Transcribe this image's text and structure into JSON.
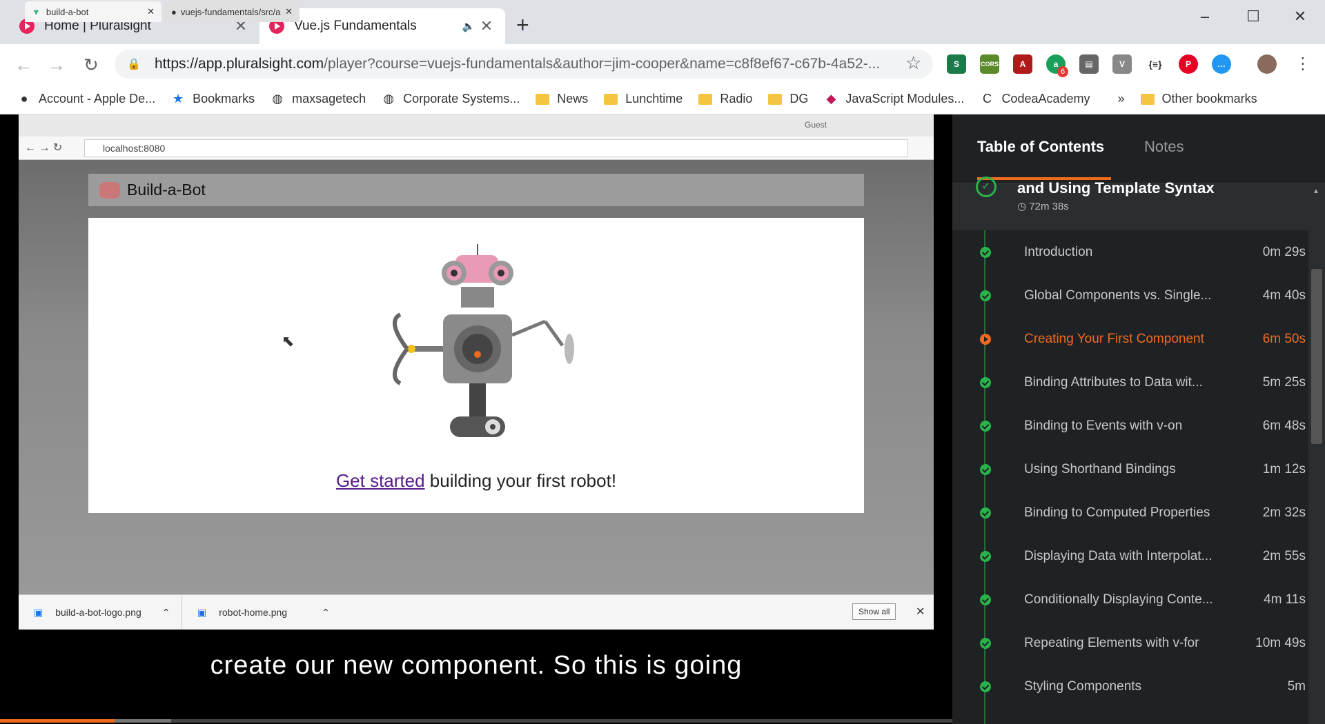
{
  "browser": {
    "tabs": [
      {
        "title": "Home | Pluralsight"
      },
      {
        "title": "Vue.js Fundamentals"
      }
    ],
    "url_host": "https://app.pluralsight.com",
    "url_path": "/player?course=vuejs-fundamentals&author=jim-cooper&name=c8f8ef67-c67b-4a52-...",
    "extension_badge": "6",
    "bookmarks": [
      "Account - Apple De...",
      "Bookmarks",
      "maxsagetech",
      "Corporate Systems...",
      "News",
      "Lunchtime",
      "Radio",
      "DG",
      "JavaScript Modules...",
      "CodeaAcademy"
    ],
    "bookmarks_overflow": "»",
    "other_bookmarks": "Other bookmarks"
  },
  "inner_browser": {
    "tabs": [
      {
        "title": "build-a-bot"
      },
      {
        "title": "vuejs-fundamentals/src/a"
      }
    ],
    "profile": "Guest",
    "address": "localhost:8080",
    "app_title": "Build-a-Bot",
    "link_text": "Get started",
    "tagline": " building your first robot!",
    "downloads": [
      "build-a-bot-logo.png",
      "robot-home.png"
    ],
    "show_all": "Show all"
  },
  "caption": "create our new component. So this is going",
  "sidebar": {
    "tab_toc": "Table of Contents",
    "tab_notes": "Notes",
    "module_title": "and Using Template Syntax",
    "module_duration": "72m 38s",
    "clips": [
      {
        "title": "Introduction",
        "duration": "0m 29s",
        "state": "done"
      },
      {
        "title": "Global Components vs. Single...",
        "duration": "4m 40s",
        "state": "done"
      },
      {
        "title": "Creating Your First Component",
        "duration": "6m 50s",
        "state": "current"
      },
      {
        "title": "Binding Attributes to Data wit...",
        "duration": "5m 25s",
        "state": "done"
      },
      {
        "title": "Binding to Events with v-on",
        "duration": "6m 48s",
        "state": "done"
      },
      {
        "title": "Using Shorthand Bindings",
        "duration": "1m 12s",
        "state": "done"
      },
      {
        "title": "Binding to Computed Properties",
        "duration": "2m 32s",
        "state": "done"
      },
      {
        "title": "Displaying Data with Interpolat...",
        "duration": "2m 55s",
        "state": "done"
      },
      {
        "title": "Conditionally Displaying Conte...",
        "duration": "4m 11s",
        "state": "done"
      },
      {
        "title": "Repeating Elements with v-for",
        "duration": "10m 49s",
        "state": "done"
      },
      {
        "title": "Styling Components",
        "duration": "5m",
        "state": "done"
      }
    ]
  },
  "colors": {
    "accent": "#f26b1d",
    "done": "#2ab34b",
    "pluralsight": "#e4245c"
  },
  "video_progress": 0.12,
  "video_buffered": 0.18
}
